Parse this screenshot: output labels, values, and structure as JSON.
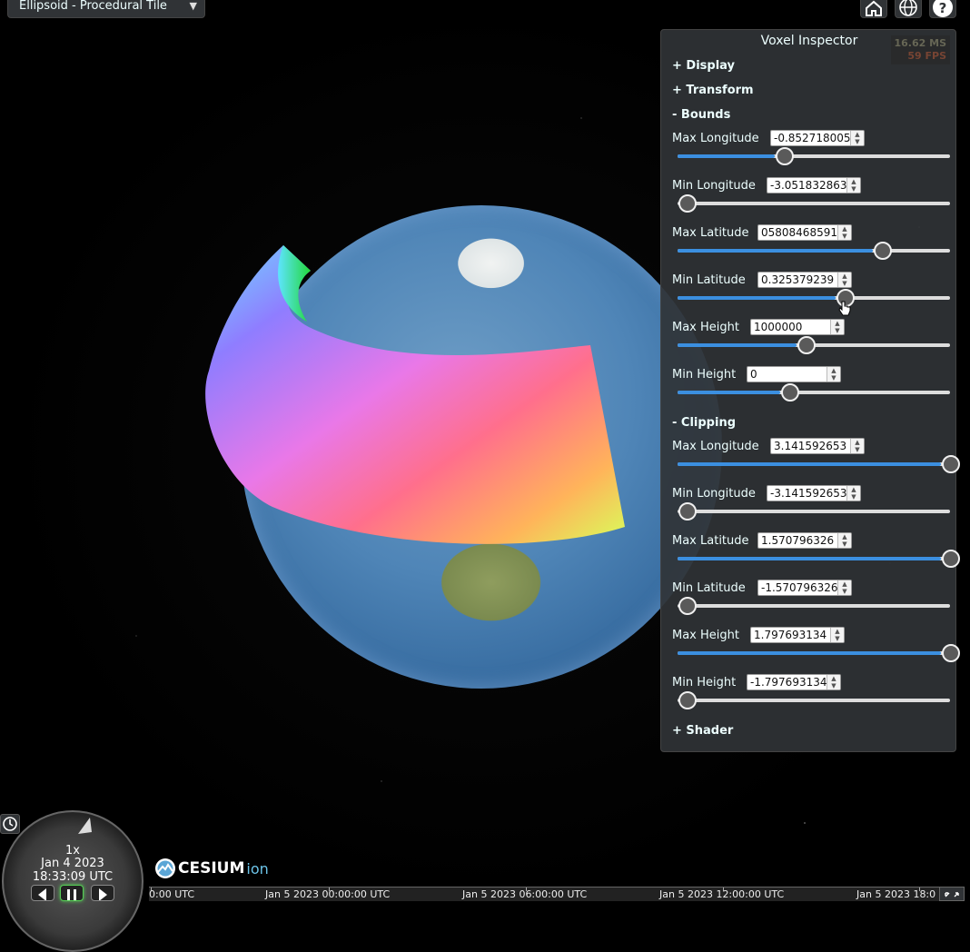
{
  "toolbar": {
    "scene_select": "Ellipsoid - Procedural Tile",
    "home_icon": "home-icon",
    "globe_icon": "globe-icon",
    "help_icon": "help-icon"
  },
  "inspector": {
    "title": "Voxel Inspector",
    "performance": {
      "ms": "16.62 MS",
      "fps": "59 FPS"
    },
    "sections": {
      "display": "+ Display",
      "transform": "+ Transform",
      "bounds": "-  Bounds",
      "clipping": "-  Clipping",
      "shader": "+ Shader"
    },
    "bounds": [
      {
        "label": "Max Longitude",
        "value": "-0.852718005",
        "fraction": 0.37
      },
      {
        "label": "Min Longitude",
        "value": "-3.051832863",
        "fraction": 0.0
      },
      {
        "label": "Max Latitude",
        "value": "05808468591",
        "fraction": 0.74
      },
      {
        "label": "Min Latitude",
        "value": "0.325379239",
        "fraction": 0.6
      },
      {
        "label": "Max Height",
        "value": "1000000",
        "fraction": 0.45
      },
      {
        "label": "Min Height",
        "value": "0",
        "fraction": 0.39
      }
    ],
    "clipping": [
      {
        "label": "Max Longitude",
        "value": "3.141592653",
        "fraction": 1.0
      },
      {
        "label": "Min Longitude",
        "value": "-3.141592653",
        "fraction": 0.0
      },
      {
        "label": "Max Latitude",
        "value": "1.570796326",
        "fraction": 1.0
      },
      {
        "label": "Min Latitude",
        "value": "-1.570796326",
        "fraction": 0.0
      },
      {
        "label": "Max Height",
        "value": "1.797693134",
        "fraction": 1.0
      },
      {
        "label": "Min Height",
        "value": "-1.797693134",
        "fraction": 0.0
      }
    ]
  },
  "clock": {
    "speed": "1x",
    "date": "Jan 4 2023",
    "time": "18:33:09 UTC"
  },
  "brand": {
    "word": "CESIUM",
    "suffix": "ion"
  },
  "timeline": {
    "labels": [
      "0:00 UTC",
      "Jan 5 2023 00:00:00 UTC",
      "Jan 5 2023 06:00:00 UTC",
      "Jan 5 2023 12:00:00 UTC",
      "Jan 5 2023 18:0"
    ]
  }
}
